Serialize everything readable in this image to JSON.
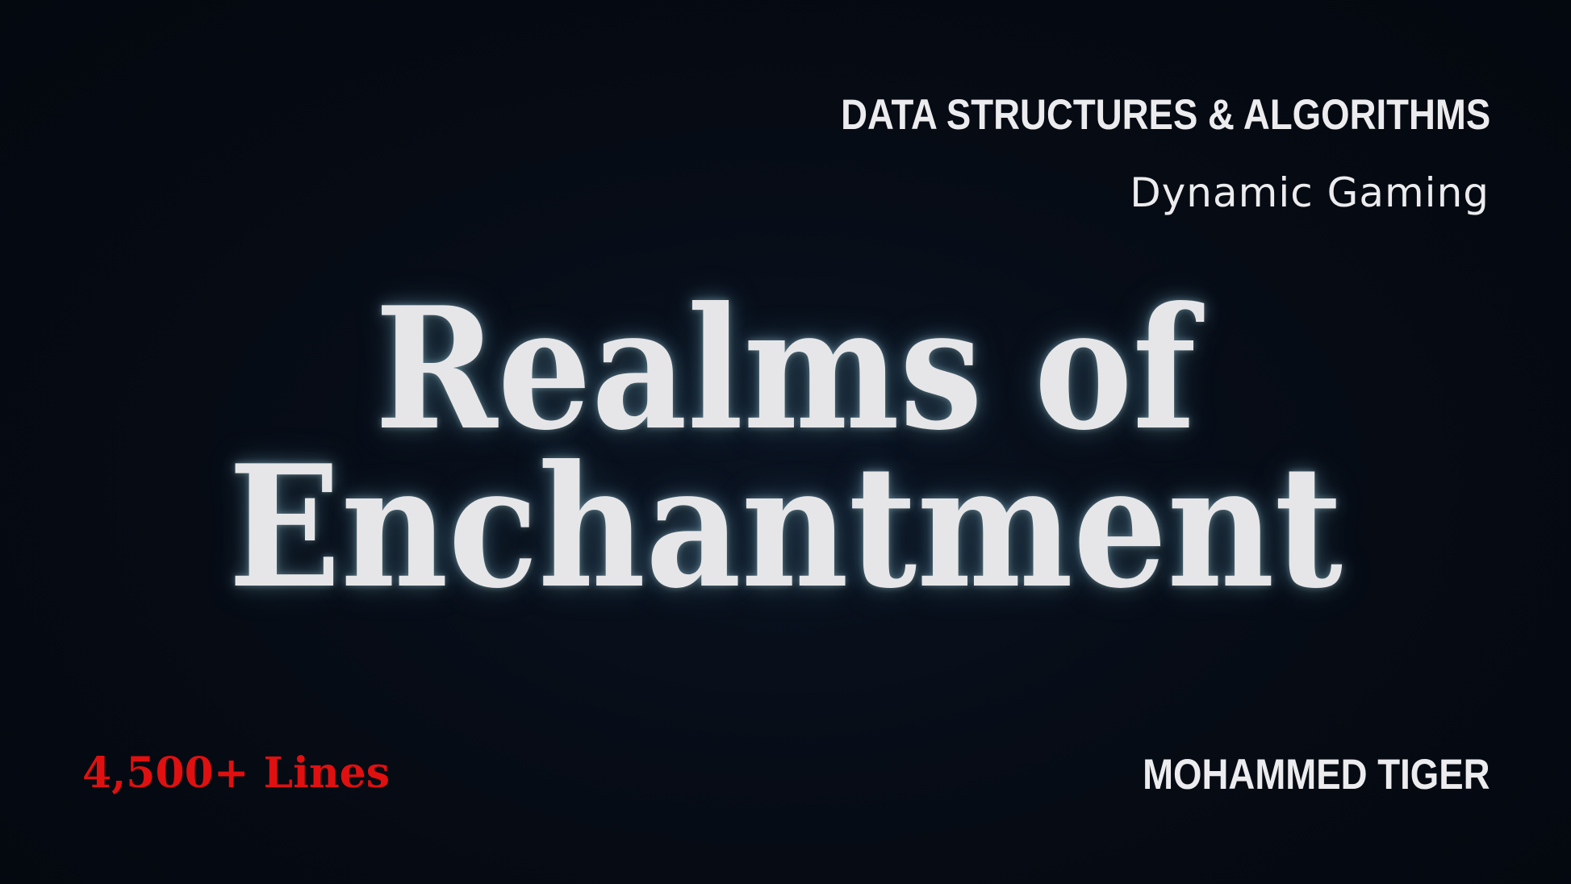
{
  "header": {
    "course": "DATA STRUCTURES & ALGORITHMS",
    "studio": "Dynamic Gaming"
  },
  "title": {
    "line1": "Realms of",
    "line2": "Enchantment"
  },
  "footer": {
    "lines_count": "4,500+ Lines",
    "author": "MOHAMMED TIGER"
  },
  "colors": {
    "background": "#050a13",
    "title_text": "#e6e6e8",
    "title_glow": "#8ccbe6",
    "accent_red": "#e01010",
    "header_text": "#ececef"
  }
}
